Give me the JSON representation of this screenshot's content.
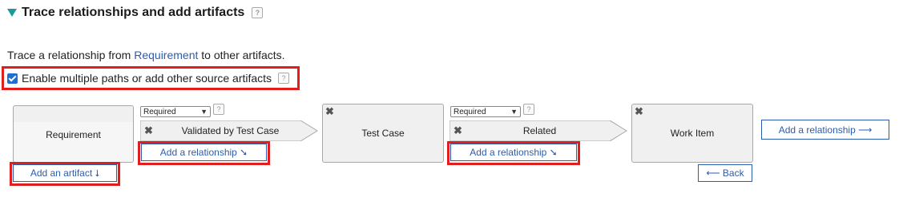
{
  "section": {
    "title": "Trace relationships and add artifacts",
    "help_icon": "question-speech-icon"
  },
  "description": {
    "prefix": "Trace a relationship from ",
    "link": "Requirement",
    "suffix": " to other artifacts."
  },
  "options": {
    "enable_multiple_label": "Enable multiple paths or add other source artifacts",
    "enable_multiple_checked": true
  },
  "path": {
    "source_node": "Requirement",
    "relationships": [
      {
        "required": "Required",
        "label": "Validated by Test Case",
        "add_label": "Add a relationship ➘"
      },
      {
        "required": "Required",
        "label": "Related",
        "add_label": "Add a relationship ➘"
      }
    ],
    "nodes": [
      "Test Case",
      "Work Item"
    ]
  },
  "actions": {
    "add_artifact": "Add an artifact ⭣",
    "add_relationship_right": "Add a relationship ⟶",
    "back": "⟵ Back"
  },
  "colors": {
    "accent_link": "#2a5db0",
    "highlight_red": "#e01e1e",
    "triangle_teal": "#1a9b9b"
  }
}
